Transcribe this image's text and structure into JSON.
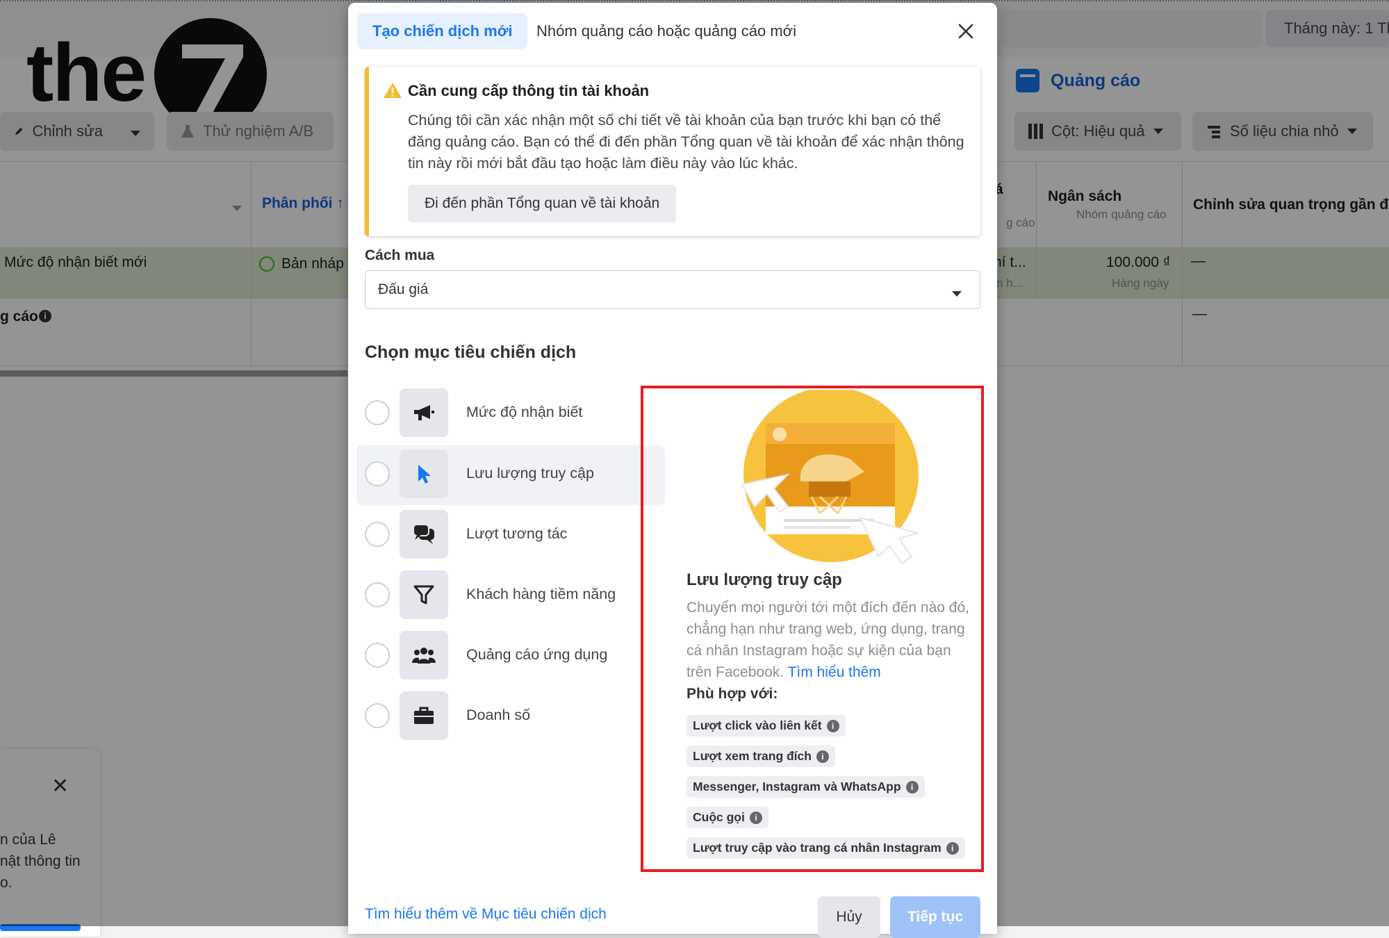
{
  "background": {
    "logo_text": "the",
    "logo_digit": "7",
    "period": "Tháng này: 1 Th",
    "ads_tab": "Quảng cáo",
    "toolbar": {
      "edit": "Chỉnh sửa",
      "ab_test": "Thử nghiệm A/B",
      "columns": "Cột: Hiệu quả",
      "breakdown": "Số liệu chia nhỏ"
    },
    "table": {
      "col_delivery": "Phân phối ↑",
      "col_budget": "Ngân sách",
      "col_budget_sub": "Nhóm quảng cáo",
      "col_recent_edits": "Chỉnh sửa quan trọng gần đây",
      "col_partial_a": "á",
      "col_partial_sub": "g cáo",
      "row1_name": "Mức độ nhận biết mới",
      "row1_status": "Bản nháp",
      "row1_partial1": "hí t...",
      "row1_partial2": "n h...",
      "row1_budget": "100.000 ₫",
      "row1_budget_sub": "Hàng ngày",
      "row1_edits": "—",
      "row2_name": "g cáo",
      "row2_edits": "—"
    },
    "side_panel": {
      "line1": "n của Lê",
      "line2": "nật thông tin",
      "line3": "o."
    }
  },
  "modal": {
    "tab_active": "Tạo chiến dịch mới",
    "tab_other": "Nhóm quảng cáo hoặc quảng cáo mới",
    "warning": {
      "title": "Cần cung cấp thông tin tài khoản",
      "body": "Chúng tôi cần xác nhận một số chi tiết về tài khoản của bạn trước khi bạn có thể đăng quảng cáo. Bạn có thể đi đến phần Tổng quan về tài khoản để xác nhận thông tin này rồi mới bắt đầu tạo hoặc làm điều này vào lúc khác.",
      "button": "Đi đến phần Tổng quan về tài khoản"
    },
    "buying_type_label": "Cách mua",
    "buying_type_value": "Đấu giá",
    "objective_heading": "Chọn mục tiêu chiến dịch",
    "objectives": [
      {
        "label": "Mức độ nhận biết",
        "icon": "megaphone-icon"
      },
      {
        "label": "Lưu lượng truy cập",
        "icon": "cursor-icon",
        "selected": true
      },
      {
        "label": "Lượt tương tác",
        "icon": "chat-bubbles-icon"
      },
      {
        "label": "Khách hàng tiềm năng",
        "icon": "funnel-icon"
      },
      {
        "label": "Quảng cáo ứng dụng",
        "icon": "people-icon"
      },
      {
        "label": "Doanh số",
        "icon": "briefcase-icon"
      }
    ],
    "detail": {
      "title": "Lưu lượng truy cập",
      "description": "Chuyển mọi người tới một đích đến nào đó, chẳng hạn như trang web, ứng dụng, trang cá nhân Instagram hoặc sự kiện của bạn trên Facebook.",
      "learn_more": "Tìm hiểu thêm",
      "fit_label": "Phù hợp với:",
      "chips": [
        "Lượt click vào liên kết",
        "Lượt xem trang đích",
        "Messenger, Instagram và WhatsApp",
        "Cuộc gọi",
        "Lượt truy cập vào trang cá nhân Instagram"
      ]
    },
    "footer_link": "Tìm hiểu thêm về Mục tiêu chiến dịch",
    "cancel": "Hủy",
    "continue": "Tiếp tục"
  },
  "colors": {
    "accent": "#1877f2",
    "highlight_border": "#e31e24",
    "warning": "#f7b928",
    "draft_row": "#dfe9d3"
  }
}
